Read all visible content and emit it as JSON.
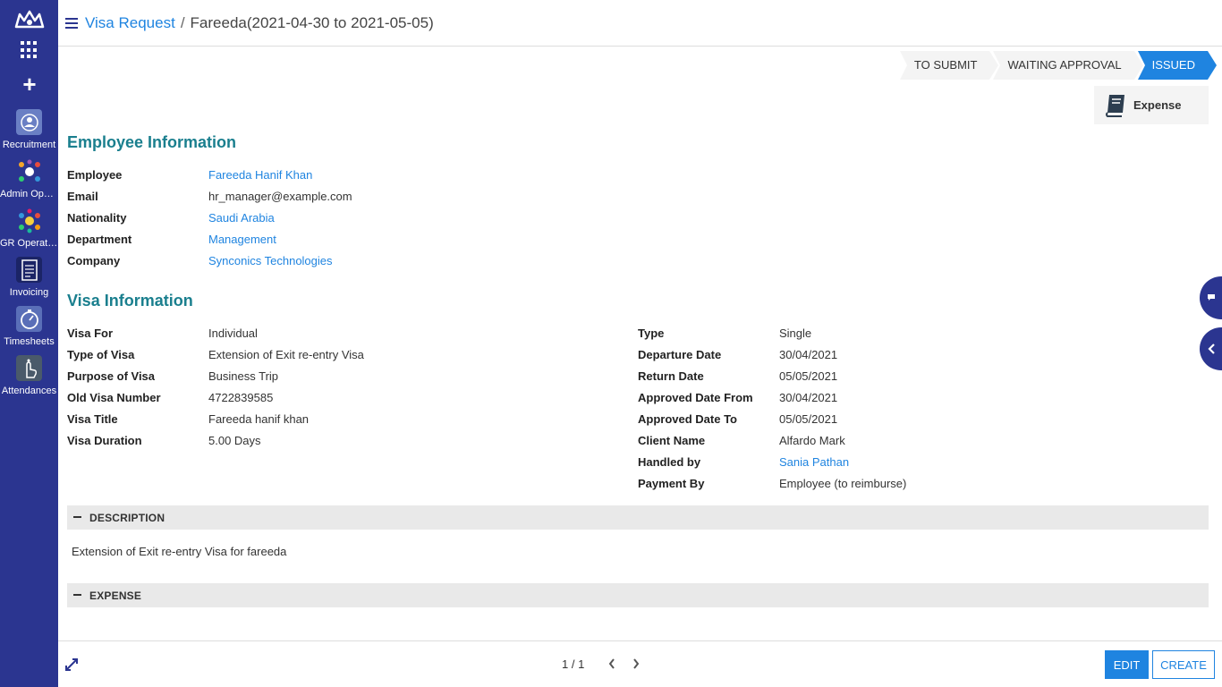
{
  "sidebar": {
    "logo": "company-crown-logo",
    "apps_icon": "grid-icon",
    "add_icon": "plus-icon",
    "apps": [
      {
        "label": "Recruitment",
        "icon": "recruitment-icon"
      },
      {
        "label": "Admin Oper...",
        "icon": "admin-operations-icon"
      },
      {
        "label": "GR Operatio...",
        "icon": "gr-operations-icon"
      },
      {
        "label": "Invoicing",
        "icon": "invoicing-icon"
      },
      {
        "label": "Timesheets",
        "icon": "timesheets-icon"
      },
      {
        "label": "Attendances",
        "icon": "attendances-icon"
      }
    ]
  },
  "header": {
    "parent": "Visa Request",
    "separator": "/",
    "current": "Fareeda(2021-04-30 to 2021-05-05)"
  },
  "statusbar": {
    "stages": [
      "TO SUBMIT",
      "WAITING APPROVAL",
      "ISSUED"
    ],
    "active": "ISSUED"
  },
  "smart_button": {
    "label": "Expense",
    "icon": "book-icon"
  },
  "employee_section": {
    "title": "Employee Information",
    "fields": [
      {
        "label": "Employee",
        "value": "Fareeda Hanif Khan"
      },
      {
        "label": "Email",
        "value": "hr_manager@example.com"
      },
      {
        "label": "Nationality",
        "value": "Saudi Arabia"
      },
      {
        "label": "Department",
        "value": "Management"
      },
      {
        "label": "Company",
        "value": "Synconics Technologies"
      }
    ]
  },
  "visa_section": {
    "title": "Visa Information",
    "left_fields": [
      {
        "label": "Visa For",
        "value": "Individual"
      },
      {
        "label": "Type of Visa",
        "value": "Extension of Exit re-entry Visa"
      },
      {
        "label": "Purpose of Visa",
        "value": "Business Trip"
      },
      {
        "label": "Old Visa Number",
        "value": "4722839585"
      },
      {
        "label": "Visa Title",
        "value": "Fareeda hanif khan"
      },
      {
        "label": "Visa Duration",
        "value": "5.00 Days"
      }
    ],
    "right_fields": [
      {
        "label": "Type",
        "value": "Single"
      },
      {
        "label": "Departure Date",
        "value": "30/04/2021"
      },
      {
        "label": "Return Date",
        "value": "05/05/2021"
      },
      {
        "label": "Approved Date From",
        "value": "30/04/2021"
      },
      {
        "label": "Approved Date To",
        "value": "05/05/2021"
      },
      {
        "label": "Client Name",
        "value": "Alfardo Mark"
      },
      {
        "label": "Handled by",
        "value": "Sania Pathan"
      },
      {
        "label": "Payment By",
        "value": "Employee (to reimburse)"
      }
    ]
  },
  "description_section": {
    "title": "DESCRIPTION",
    "text": "Extension of Exit re-entry Visa for fareeda"
  },
  "expense_section": {
    "title": "EXPENSE"
  },
  "footer": {
    "pager": "1 / 1",
    "edit_label": "EDIT",
    "create_label": "CREATE"
  },
  "colors": {
    "sidebar": "#2b3590",
    "accent": "#1f84e0",
    "section_title": "#1a7f8e"
  }
}
